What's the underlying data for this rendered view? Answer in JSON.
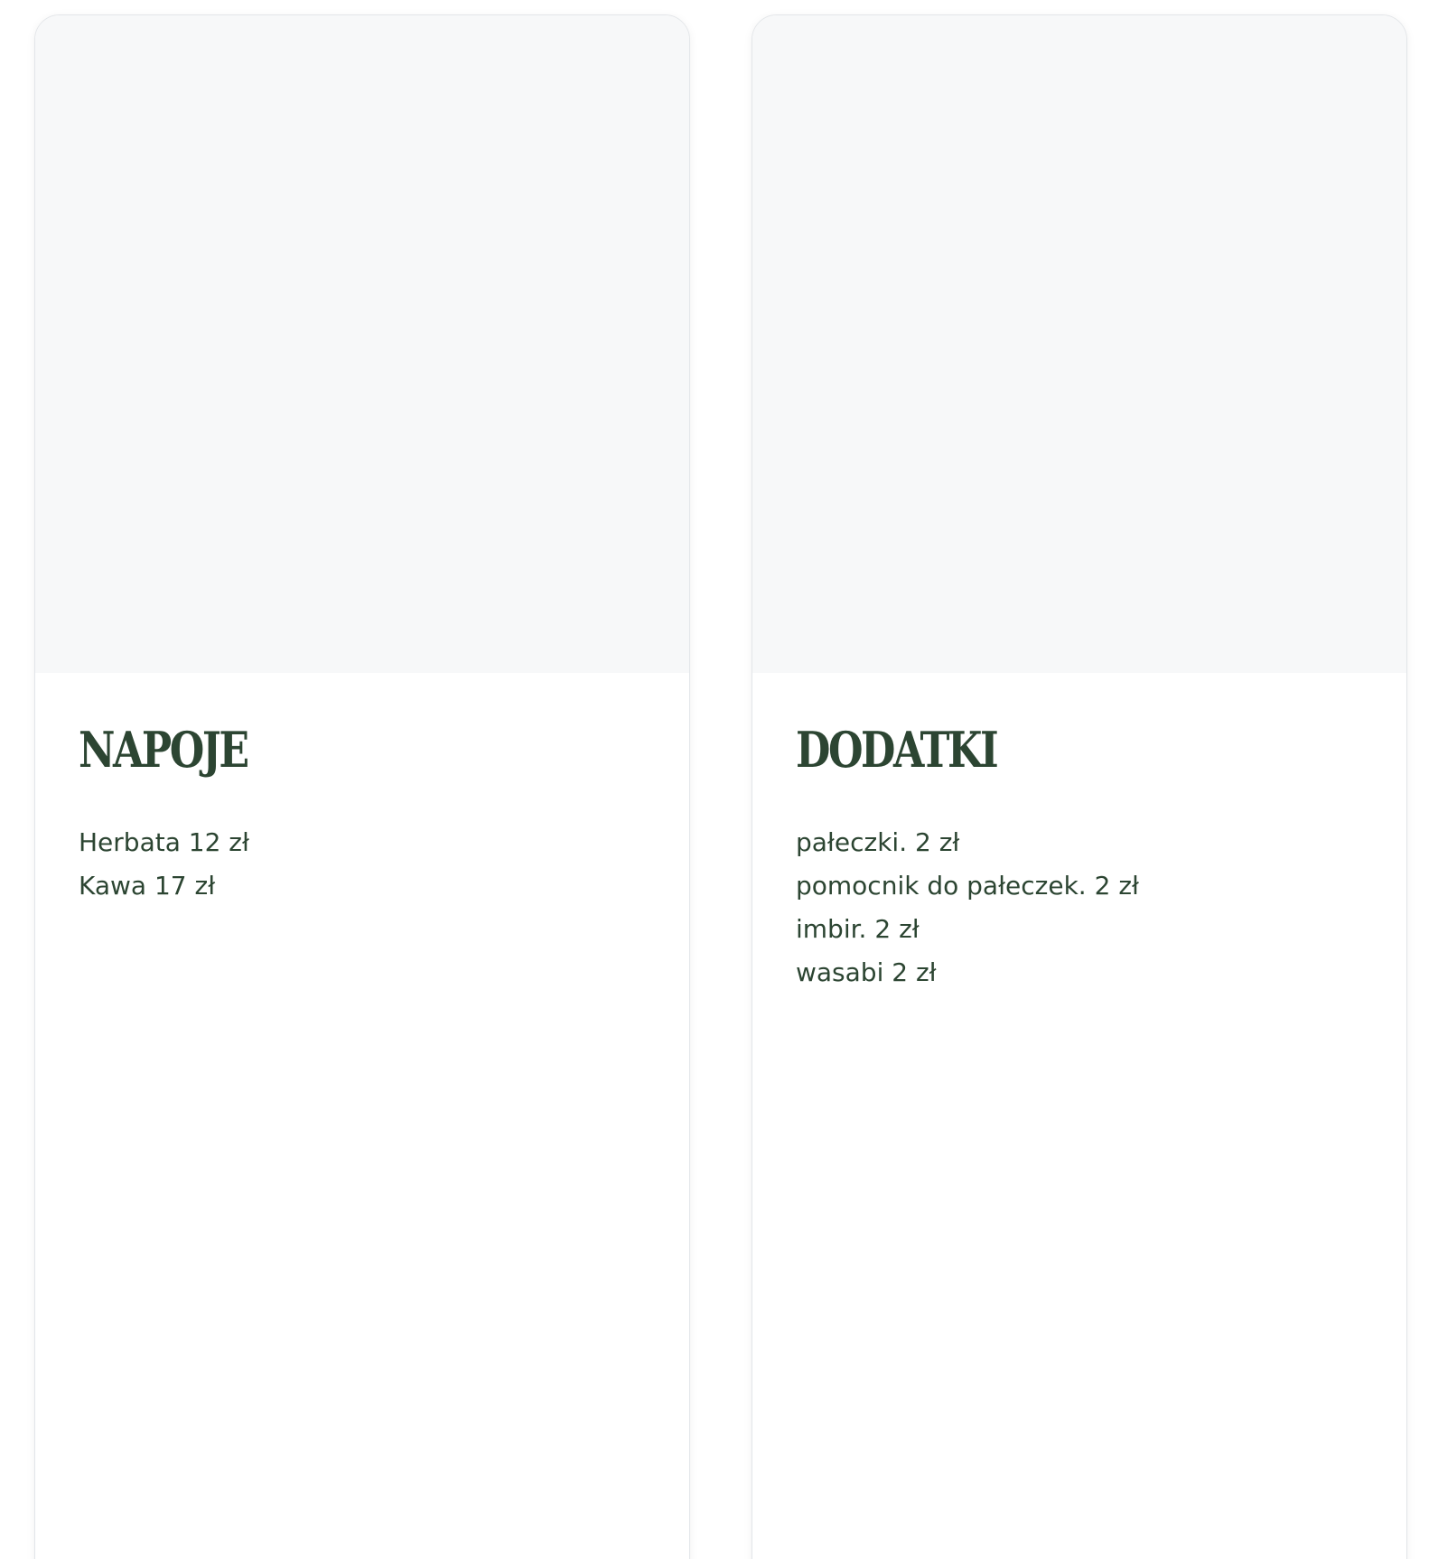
{
  "cards": [
    {
      "title": "NAPOJE",
      "items": [
        "Herbata 12 zł",
        "Kawa 17 zł"
      ]
    },
    {
      "title": "DODATKI",
      "items": [
        "pałeczki. 2 zł",
        "pomocnik do pałeczek. 2 zł",
        "imbir. 2 zł",
        "wasabi 2 zł"
      ]
    }
  ],
  "colors": {
    "text": "#2c4532",
    "image_placeholder": "#f7f8f9",
    "card_border": "#e3e6e9"
  }
}
